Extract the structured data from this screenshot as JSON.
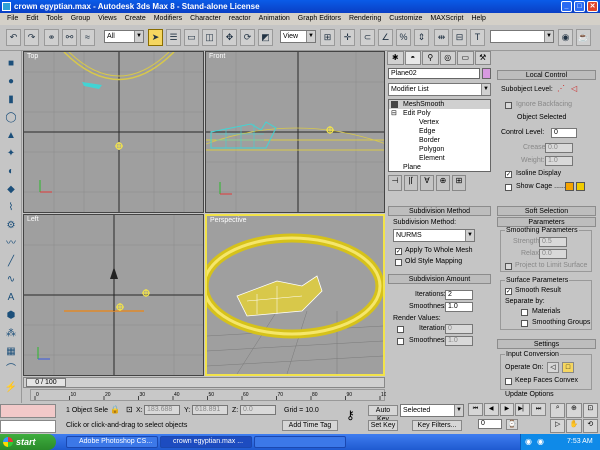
{
  "window": {
    "title": "crown egyptian.max - Autodesk 3ds Max 8 - Stand-alone License"
  },
  "menu": [
    "File",
    "Edit",
    "Tools",
    "Group",
    "Views",
    "Create",
    "Modifiers",
    "Character",
    "reactor",
    "Animation",
    "Graph Editors",
    "Rendering",
    "Customize",
    "MAXScript",
    "Help"
  ],
  "toolbar": {
    "selection_filter": "All",
    "ref_coord": "View"
  },
  "viewports": {
    "top": "Top",
    "front": "Front",
    "left": "Left",
    "perspective": "Perspective"
  },
  "modify": {
    "object_name": "Plane02",
    "modifier_list": "Modifier List",
    "stack": [
      "MeshSmooth",
      "Edit Poly",
      "Vertex",
      "Edge",
      "Border",
      "Polygon",
      "Element",
      "Plane"
    ]
  },
  "subdivision": {
    "header": "Subdivision Method",
    "method_label": "Subdivision Method:",
    "method_value": "NURMS",
    "apply_whole": "Apply To Whole Mesh",
    "old_style": "Old Style Mapping",
    "amount_header": "Subdivision Amount",
    "iterations_label": "Iterations:",
    "iterations": "2",
    "smoothness_label": "Smoothness:",
    "smoothness": "1.0",
    "render_values": "Render Values:",
    "r_iterations_label": "Iterations",
    "r_iterations": "0",
    "r_smoothness_label": "Smoothness",
    "r_smoothness": "1.0"
  },
  "local_control": {
    "header": "Local Control",
    "subobject_label": "Subobject Level:",
    "ignore_backfacing": "Ignore Backfacing",
    "object_selected": "Object Selected",
    "control_level_label": "Control Level:",
    "control_level": "0",
    "crease_label": "Crease:",
    "crease": "0.0",
    "weight_label": "Weight:",
    "weight": "1.0",
    "isoline": "Isoline Display",
    "show_cage": "Show Cage ......",
    "cage_color1": "#f5a300",
    "cage_color2": "#f0cc00"
  },
  "soft_selection": {
    "header": "Soft Selection"
  },
  "parameters": {
    "header": "Parameters",
    "smoothing_params": "Smoothing Parameters",
    "strength_label": "Strength:",
    "strength": "0.5",
    "relax_label": "Relax:",
    "relax": "0.0",
    "project_limit": "Project to Limit Surface",
    "surface_params": "Surface Parameters",
    "smooth_result": "Smooth Result",
    "separate_by": "Separate by:",
    "materials": "Materials",
    "smoothing_groups": "Smoothing Groups"
  },
  "settings": {
    "header": "Settings",
    "input_conversion": "Input Conversion",
    "operate_on": "Operate On:",
    "keep_faces_convex": "Keep Faces Convex",
    "update_options": "Update Options"
  },
  "timeline": {
    "frame": "0 / 100",
    "ticks": [
      "0",
      "10",
      "20",
      "30",
      "40",
      "50",
      "60",
      "70",
      "80",
      "90",
      "100"
    ]
  },
  "status": {
    "selection": "1 Object Sele",
    "x_label": "X:",
    "x": "183.688",
    "y_label": "Y:",
    "y": "618.891",
    "z_label": "Z:",
    "z": "0.0",
    "grid": "Grid = 10.0",
    "prompt": "Click or click-and-drag to select objects",
    "add_time_tag": "Add Time Tag",
    "auto_key": "Auto Key",
    "set_key": "Set Key",
    "selected": "Selected",
    "key_filters": "Key Filters...",
    "frame_spinner": "0"
  },
  "taskbar": {
    "start": "start",
    "tasks": [
      "Adobe Photoshop CS...",
      "crown egyptian.max ...",
      ""
    ],
    "clock": "7:53 AM"
  }
}
